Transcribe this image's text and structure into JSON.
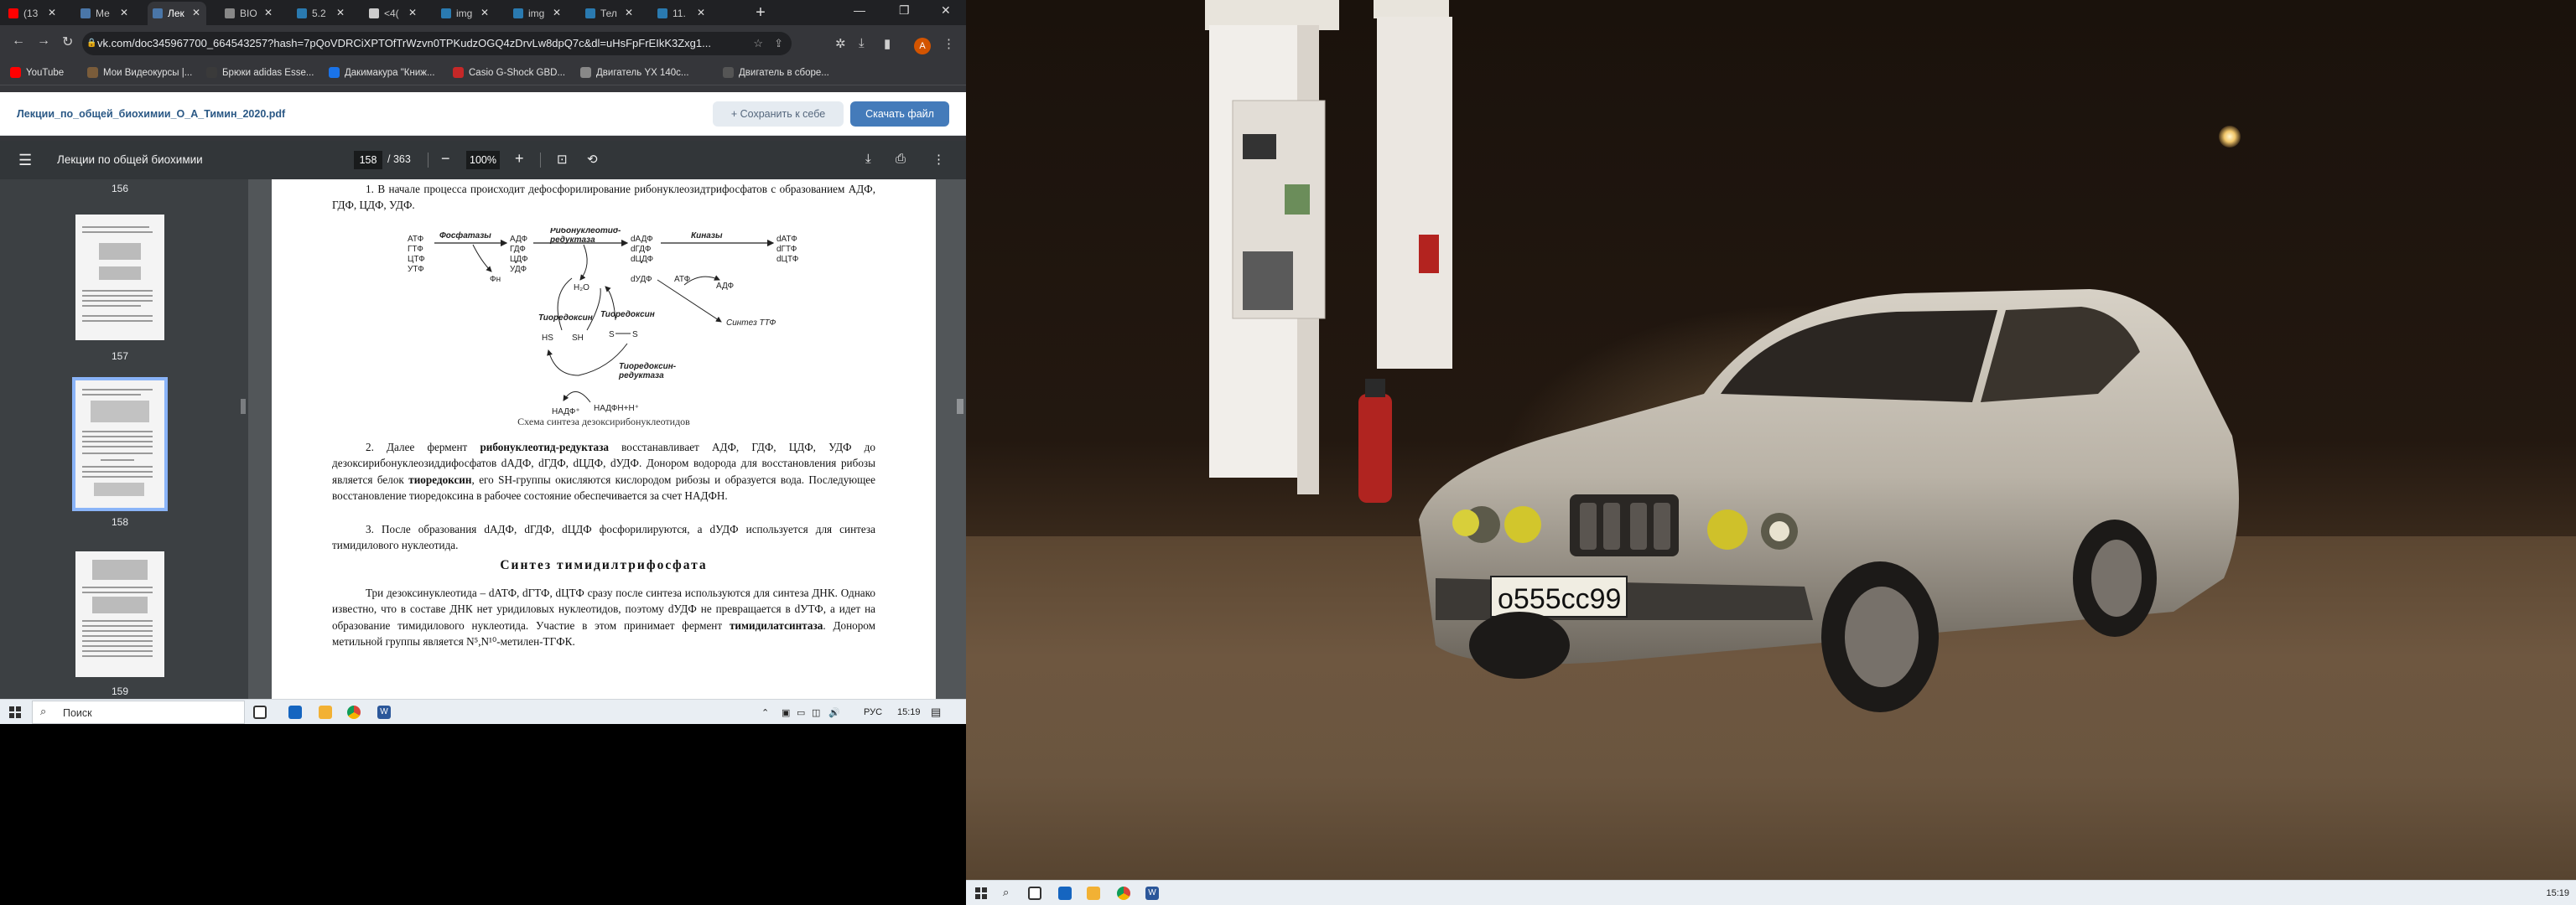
{
  "browser": {
    "tabs": [
      {
        "label": "(13",
        "icon": "youtube-icon",
        "color": "#ff0000"
      },
      {
        "label": "Ме",
        "icon": "vk-icon",
        "color": "#4a76a8"
      },
      {
        "label": "Лек",
        "icon": "vk-icon",
        "color": "#4a76a8",
        "active": true
      },
      {
        "label": "BIO",
        "icon": "globe-icon",
        "color": "#888888"
      },
      {
        "label": "5.2",
        "icon": "s-icon",
        "color": "#2a7ab0"
      },
      {
        "label": "<4(",
        "icon": "square-icon",
        "color": "#cccccc"
      },
      {
        "label": "img",
        "icon": "s-icon",
        "color": "#2a7ab0"
      },
      {
        "label": "img",
        "icon": "s-icon",
        "color": "#2a7ab0"
      },
      {
        "label": "Тел",
        "icon": "s-icon",
        "color": "#2a7ab0"
      },
      {
        "label": "11.",
        "icon": "s-icon",
        "color": "#2a7ab0"
      }
    ],
    "url": "vk.com/doc345967700_664543257?hash=7pQoVDRCiXPTOfTrWzvn0TPKudzOGQ4zDrvLw8dpQ7c&dl=uHsFpFrEIkK3Zxg1...",
    "profile_initial": "A",
    "bookmarks": [
      {
        "label": "YouTube",
        "color": "#ff0000"
      },
      {
        "label": "Мои Видеокурсы |...",
        "color": "#7a5c3a"
      },
      {
        "label": "Брюки adidas Esse...",
        "color": "#3a3a3a"
      },
      {
        "label": "Дакимакура \"Книж...",
        "color": "#1a73e8"
      },
      {
        "label": "Casio G-Shock GBD...",
        "color": "#c62828"
      },
      {
        "label": "Двигатель YX 140с...",
        "color": "#888888"
      },
      {
        "label": "Двигатель в сборе...",
        "color": "#555555"
      }
    ]
  },
  "vk": {
    "filename": "Лекции_по_общей_биохимии_О_А_Тимин_2020.pdf",
    "save_label": "Сохранить к себе",
    "download_label": "Скачать файл"
  },
  "pdf": {
    "title": "Лекции по общей биохимии",
    "page": "158",
    "total": "/ 363",
    "zoom": "100%",
    "thumbs": [
      "156",
      "157",
      "158",
      "159"
    ],
    "p1": "1. В начале процесса происходит дефосфорилирование рибонуклеозидтрифосфатов с образованием АДФ, ГДФ, ЦДФ, УДФ.",
    "caption": "Схема синтеза дезоксирибонуклеотидов",
    "p2_pre": "2. Далее фермент ",
    "p2_bold1": "рибонуклеотид-редуктаза",
    "p2_mid": " восстанавливает АДФ, ГДФ, ЦДФ, УДФ до дезоксирибонуклеозиддифосфатов dАДФ, dГДФ, dЦДФ, dУДФ. Донором водорода для восстановления рибозы является белок ",
    "p2_bold2": "тиоредоксин",
    "p2_post": ", его SH-группы окисляются кислородом рибозы и образуется вода. Последующее восстановление тиоредоксина в рабочее состояние обеспечивается за счет НАДФН.",
    "p3": "3. После образования dАДФ, dГДФ, dЦДФ фосфорилируются, а dУДФ используется для синтеза тимидилового нуклеотида.",
    "heading": "Синтез тимидилтрифосфата",
    "p4_pre": "Три дезоксинуклеотида – dАТФ, dГТФ, dЦТФ сразу после синтеза используются для синтеза ДНК. Однако известно, что в составе ДНК нет уридиловых нуклеотидов, поэтому dУДФ не превращается в dУТФ, а идет на образование тимидилового нуклеотида. Участие в этом принимает фермент ",
    "p4_bold": "тимидилатсинтаза",
    "p4_post": ". Донором метильной группы является N⁵,N¹⁰-метилен-ТГФК.",
    "scheme": {
      "left": [
        "АТФ",
        "ГТФ",
        "ЦТФ",
        "УТФ"
      ],
      "phosphatase": "Фосфатазы",
      "pi": "Фн",
      "mid": [
        "АДФ",
        "ГДФ",
        "ЦДФ",
        "УДФ"
      ],
      "reductase": "Рибонуклеотид-\nредуктаза",
      "water": "H₂O",
      "dmid": [
        "dАДФ",
        "dГДФ",
        "dЦДФ",
        "dУДФ"
      ],
      "kinase": "Киназы",
      "right": [
        "dАТФ",
        "dГТФ",
        "dЦТФ"
      ],
      "atp": "АТФ",
      "adp": "АДФ",
      "ttf": "Синтез ТТФ",
      "thio1": "Тиоредоксин",
      "thio2": "Тиоредоксин",
      "hs": "HS",
      "sh": "SH",
      "s1": "S",
      "s2": "S",
      "thio_red": "Тиоредоксин-\nредуктаза",
      "nadp": "НАДФ⁺",
      "nadph": "НАДФН+Н⁺"
    }
  },
  "taskbar": {
    "search_label": "Поиск",
    "lang": "РУС",
    "time": "15:19"
  },
  "photo": {
    "plate": "о555сс99"
  }
}
